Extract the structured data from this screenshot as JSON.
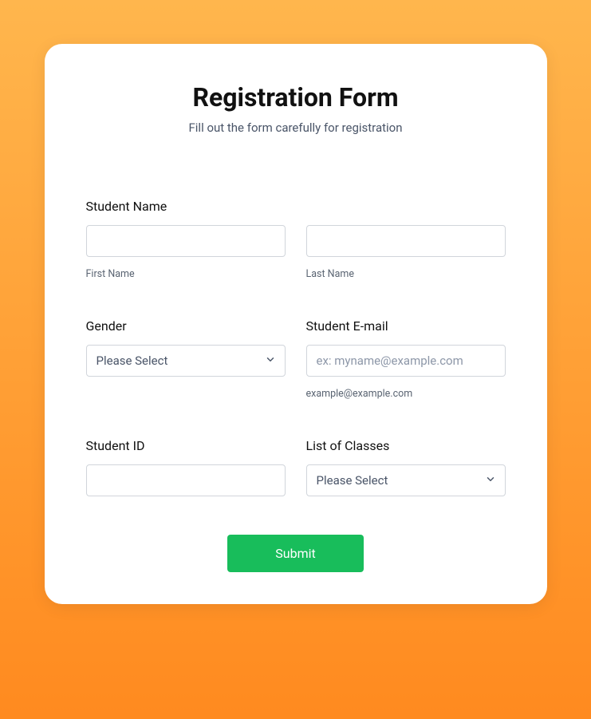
{
  "header": {
    "title": "Registration Form",
    "subtitle": "Fill out the form carefully for registration"
  },
  "studentName": {
    "label": "Student Name",
    "first": {
      "value": "",
      "sublabel": "First Name"
    },
    "last": {
      "value": "",
      "sublabel": "Last Name"
    }
  },
  "gender": {
    "label": "Gender",
    "selected": "Please Select"
  },
  "email": {
    "label": "Student E-mail",
    "value": "",
    "placeholder": "ex: myname@example.com",
    "sublabel": "example@example.com"
  },
  "studentId": {
    "label": "Student ID",
    "value": ""
  },
  "classes": {
    "label": "List of Classes",
    "selected": "Please Select"
  },
  "submit": {
    "label": "Submit"
  }
}
